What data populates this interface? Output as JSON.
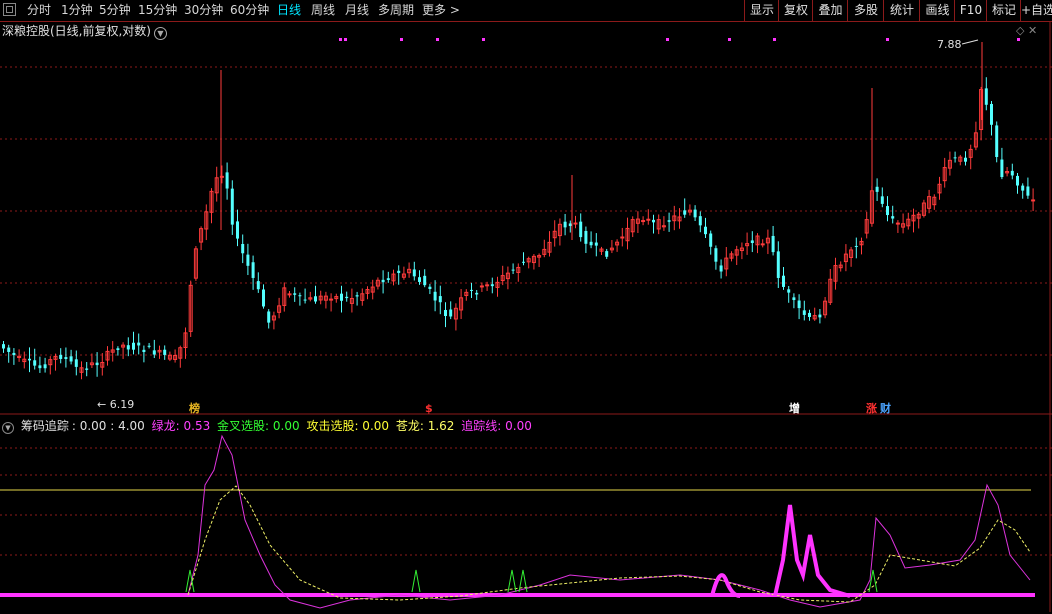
{
  "toolbar": {
    "periods": [
      "分时",
      "1分钟",
      "5分钟",
      "15分钟",
      "30分钟",
      "60分钟",
      "日线",
      "周线",
      "月线",
      "多周期",
      "更多 >"
    ],
    "active_period": "日线",
    "right_buttons": [
      "显示",
      "复权",
      "叠加",
      "多股",
      "统计",
      "画线",
      "F10",
      "标记",
      "+自选"
    ]
  },
  "chart": {
    "title": "深粮控股(日线,前复权,对数)",
    "high_label": "7.88",
    "low_label": "6.19",
    "event_markers": [
      {
        "label": "榜",
        "color": "#e6b422"
      },
      {
        "label": "$",
        "color": "#ff3030"
      },
      {
        "label": "增",
        "color": "#ffffff"
      },
      {
        "label": "涨",
        "color": "#ff3030"
      },
      {
        "label": "财",
        "color": "#4aa3ff"
      }
    ]
  },
  "indicator": {
    "name": "筹码追踪",
    "params": ": 0.00 : 4.00",
    "items": [
      {
        "label": "绿龙: 0.53",
        "color": "#ff40ff"
      },
      {
        "label": "金叉选股: 0.00",
        "color": "#33ff33"
      },
      {
        "label": "攻击选股: 0.00",
        "color": "#ffff33"
      },
      {
        "label": "苍龙: 1.62",
        "color": "#ffff66"
      },
      {
        "label": "追踪线: 0.00",
        "color": "#ff40ff"
      }
    ]
  },
  "colors": {
    "up": "#ff3b3b",
    "down": "#54ffff",
    "grid": "#8b1a1a",
    "magenta": "#ff33ff",
    "yellow": "#ffff55"
  }
}
